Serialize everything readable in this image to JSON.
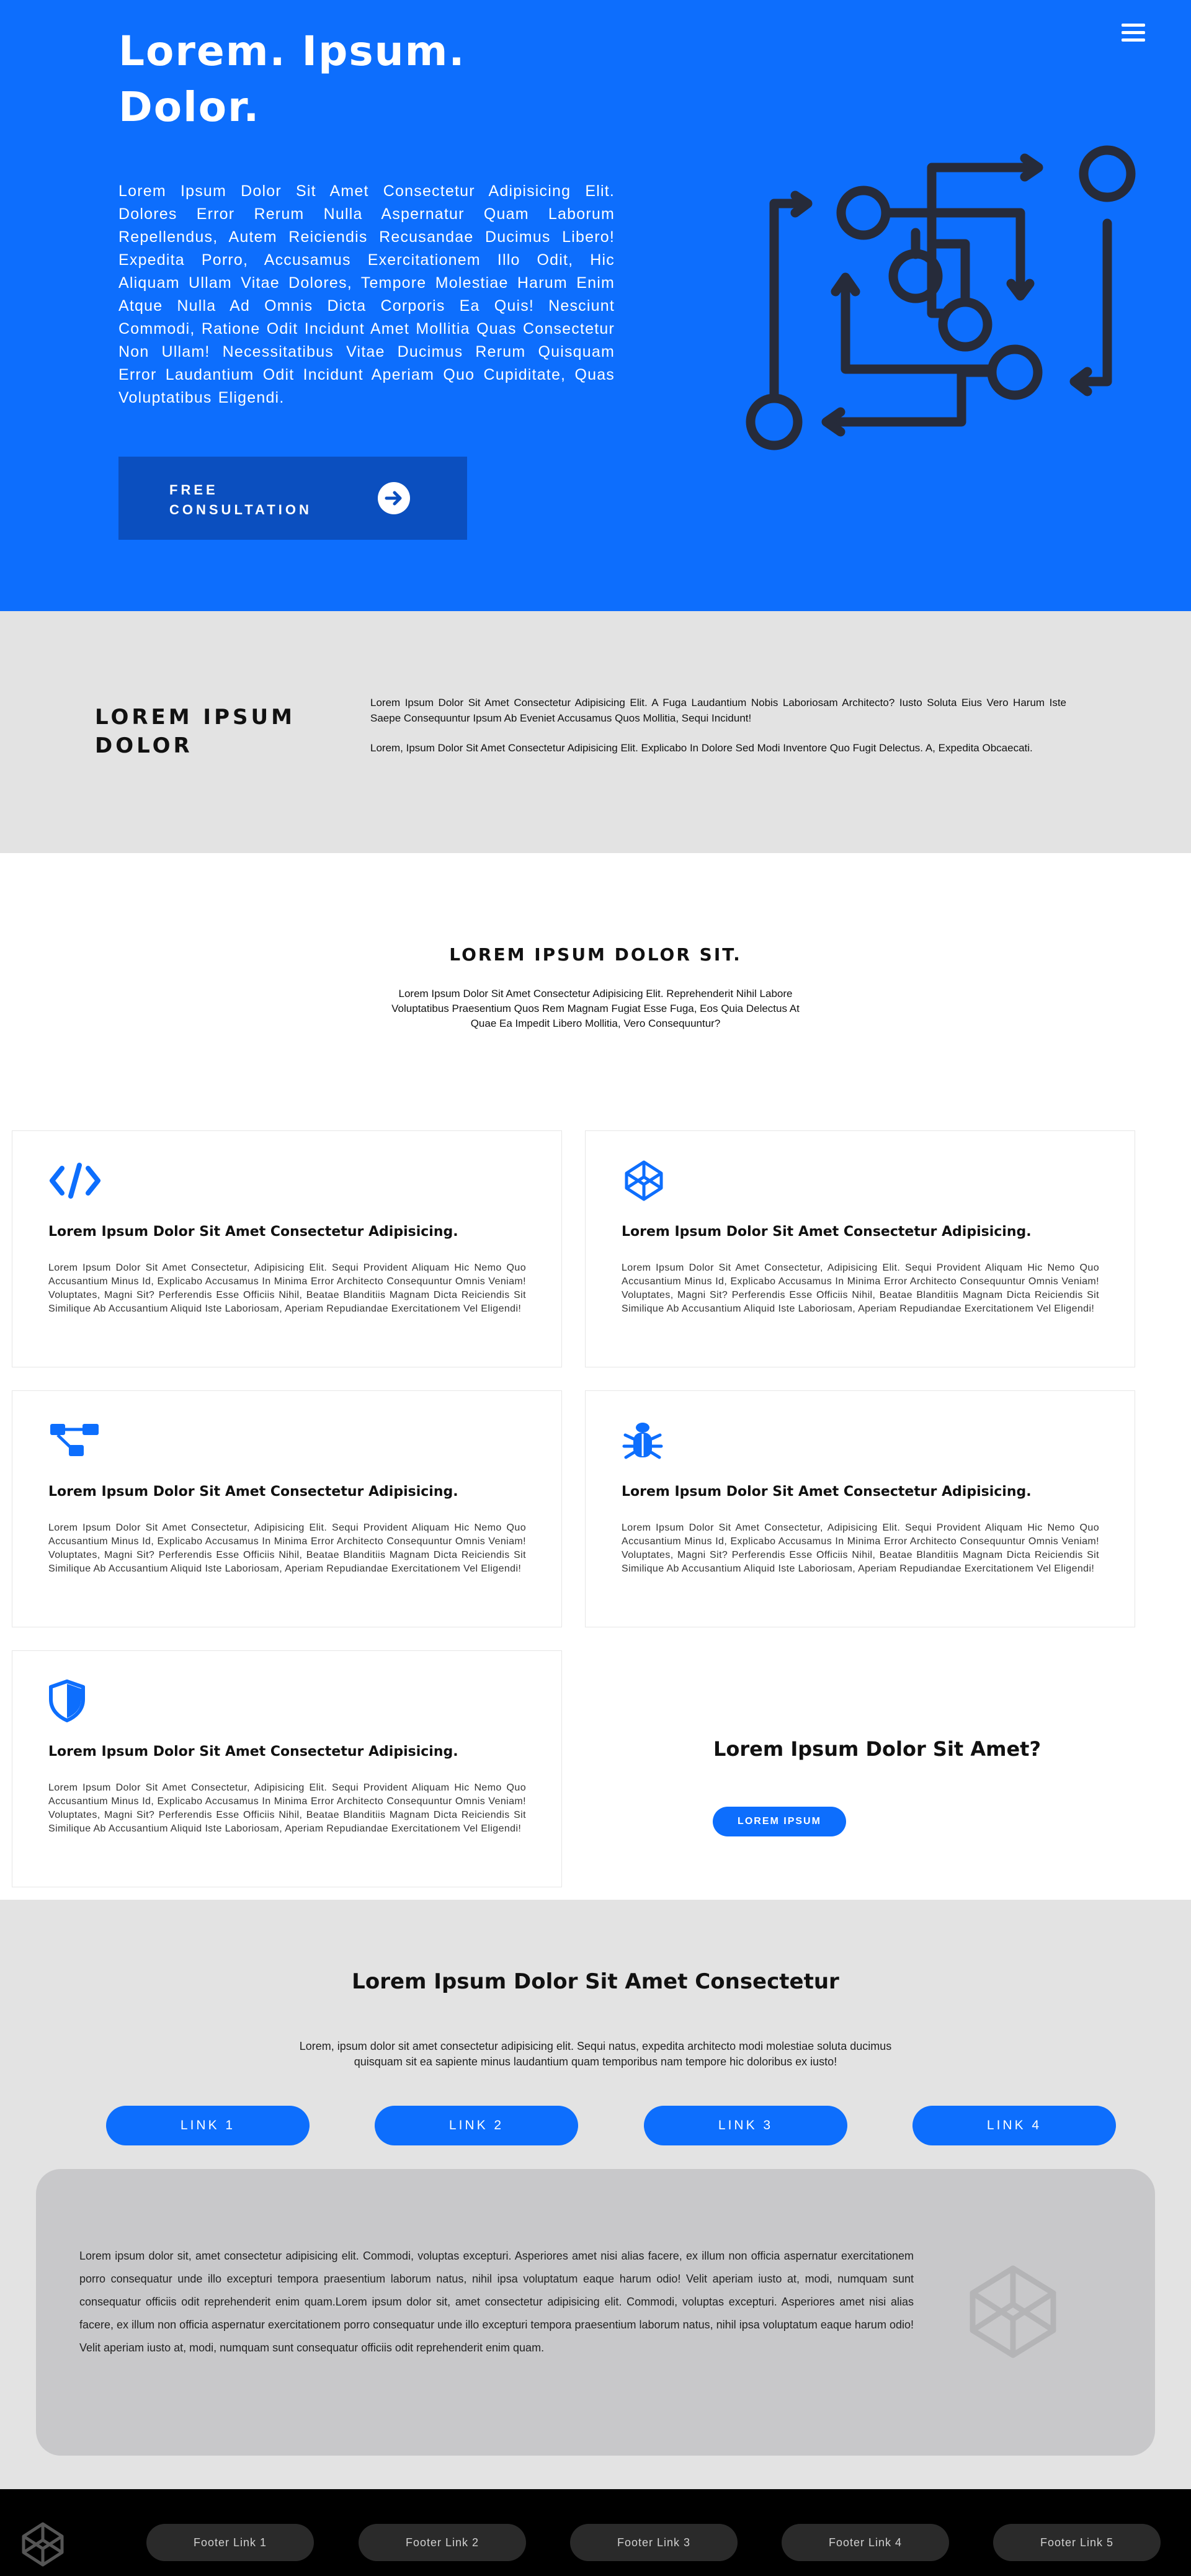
{
  "hero": {
    "title": "Lorem. Ipsum. Dolor.",
    "text": "Lorem Ipsum Dolor Sit Amet Consectetur Adipisicing Elit. Dolores Error Rerum Nulla Aspernatur Quam Laborum Repellendus, Autem Reiciendis Recusandae Ducimus Libero! Expedita Porro, Accusamus Exercitationem Illo Odit, Hic Aliquam Ullam Vitae Dolores, Tempore Molestiae Harum Enim Atque Nulla Ad Omnis Dicta Corporis Ea Quis! Nesciunt Commodi, Ratione Odit Incidunt Amet Mollitia Quas Consectetur Non Ullam! Necessitatibus Vitae Ducimus Rerum Quisquam Error Laudantium Odit Incidunt Aperiam Quo Cupiditate, Quas Voluptatibus Eligendi.",
    "button_label": "FREE CONSULTATION",
    "accent": "#0d6efd",
    "button_color": "#0b4fbf",
    "icons": [
      "menu-icon",
      "arrow-right-icon",
      "workflow-illustration"
    ]
  },
  "about": {
    "title": "LOREM IPSUM DOLOR",
    "p1": "Lorem Ipsum Dolor Sit Amet Consectetur Adipisicing Elit. A Fuga Laudantium Nobis Laboriosam Architecto? Iusto Soluta Eius Vero Harum Iste Saepe Consequuntur Ipsum Ab Eveniet Accusamus Quos Mollitia, Sequi Incidunt!",
    "p2": "Lorem, Ipsum Dolor Sit Amet Consectetur Adipisicing Elit. Explicabo In Dolore Sed Modi Inventore Quo Fugit Delectus. A, Expedita Obcaecati."
  },
  "services": {
    "title": "LOREM IPSUM DOLOR SIT.",
    "subtitle": "Lorem Ipsum Dolor Sit Amet Consectetur Adipisicing Elit. Reprehenderit Nihil Labore Voluptatibus Praesentium Quos Rem Magnam Fugiat Esse Fuga, Eos Quia Delectus At Quae Ea Impedit Libero Mollitia, Vero Consequuntur?",
    "cards": [
      {
        "icon": "code-icon",
        "title": "Lorem Ipsum Dolor Sit Amet Consectetur Adipisicing.",
        "text": "Lorem Ipsum Dolor Sit Amet Consectetur, Adipisicing Elit. Sequi Provident Aliquam Hic Nemo Quo Accusantium Minus Id, Explicabo Accusamus In Minima Error Architecto Consequuntur Omnis Veniam! Voluptates, Magni Sit? Perferendis Esse Officiis Nihil, Beatae Blanditiis Magnam Dicta Reiciendis Sit Similique Ab Accusantium Aliquid Iste Laboriosam, Aperiam Repudiandae Exercitationem Vel Eligendi!"
      },
      {
        "icon": "codepen-icon",
        "title": "Lorem Ipsum Dolor Sit Amet Consectetur Adipisicing.",
        "text": "Lorem Ipsum Dolor Sit Amet Consectetur, Adipisicing Elit. Sequi Provident Aliquam Hic Nemo Quo Accusantium Minus Id, Explicabo Accusamus In Minima Error Architecto Consequuntur Omnis Veniam! Voluptates, Magni Sit? Perferendis Esse Officiis Nihil, Beatae Blanditiis Magnam Dicta Reiciendis Sit Similique Ab Accusantium Aliquid Iste Laboriosam, Aperiam Repudiandae Exercitationem Vel Eligendi!"
      },
      {
        "icon": "sitemap-icon",
        "title": "Lorem Ipsum Dolor Sit Amet Consectetur Adipisicing.",
        "text": "Lorem Ipsum Dolor Sit Amet Consectetur, Adipisicing Elit. Sequi Provident Aliquam Hic Nemo Quo Accusantium Minus Id, Explicabo Accusamus In Minima Error Architecto Consequuntur Omnis Veniam! Voluptates, Magni Sit? Perferendis Esse Officiis Nihil, Beatae Blanditiis Magnam Dicta Reiciendis Sit Similique Ab Accusantium Aliquid Iste Laboriosam, Aperiam Repudiandae Exercitationem Vel Eligendi!"
      },
      {
        "icon": "bug-icon",
        "title": "Lorem Ipsum Dolor Sit Amet Consectetur Adipisicing.",
        "text": "Lorem Ipsum Dolor Sit Amet Consectetur, Adipisicing Elit. Sequi Provident Aliquam Hic Nemo Quo Accusantium Minus Id, Explicabo Accusamus In Minima Error Architecto Consequuntur Omnis Veniam! Voluptates, Magni Sit? Perferendis Esse Officiis Nihil, Beatae Blanditiis Magnam Dicta Reiciendis Sit Similique Ab Accusantium Aliquid Iste Laboriosam, Aperiam Repudiandae Exercitationem Vel Eligendi!"
      },
      {
        "icon": "shield-icon",
        "title": "Lorem Ipsum Dolor Sit Amet Consectetur Adipisicing.",
        "text": "Lorem Ipsum Dolor Sit Amet Consectetur, Adipisicing Elit. Sequi Provident Aliquam Hic Nemo Quo Accusantium Minus Id, Explicabo Accusamus In Minima Error Architecto Consequuntur Omnis Veniam! Voluptates, Magni Sit? Perferendis Esse Officiis Nihil, Beatae Blanditiis Magnam Dicta Reiciendis Sit Similique Ab Accusantium Aliquid Iste Laboriosam, Aperiam Repudiandae Exercitationem Vel Eligendi!"
      }
    ],
    "cta_question": "Lorem Ipsum Dolor Sit Amet?",
    "cta_button": "LOREM IPSUM"
  },
  "links": {
    "title": "Lorem Ipsum Dolor Sit Amet Consectetur",
    "subtitle": "Lorem, ipsum dolor sit amet consectetur adipisicing elit. Sequi natus, expedita architecto modi molestiae soluta ducimus quisquam sit ea sapiente minus laudantium quam temporibus nam tempore hic doloribus ex iusto!",
    "buttons": [
      "LINK 1",
      "LINK 2",
      "LINK 3",
      "LINK 4"
    ],
    "panel_text": "Lorem ipsum dolor sit, amet consectetur adipisicing elit. Commodi, voluptas excepturi. Asperiores amet nisi alias facere, ex illum non officia aspernatur exercitationem porro consequatur unde illo excepturi tempora praesentium laborum natus, nihil ipsa voluptatum eaque harum odio! Velit aperiam iusto at, modi, numquam sunt consequatur officiis odit reprehenderit enim quam.Lorem ipsum dolor sit, amet consectetur adipisicing elit. Commodi, voluptas excepturi. Asperiores amet nisi alias facere, ex illum non officia aspernatur exercitationem porro consequatur unde illo excepturi tempora praesentium laborum natus, nihil ipsa voluptatum eaque harum odio! Velit aperiam iusto at, modi, numquam sunt consequatur officiis odit reprehenderit enim quam."
  },
  "footer": {
    "links": [
      "Footer Link 1",
      "Footer Link 2",
      "Footer Link 3",
      "Footer Link 4",
      "Footer Link 5"
    ],
    "logo_icon": "codepen-icon"
  }
}
